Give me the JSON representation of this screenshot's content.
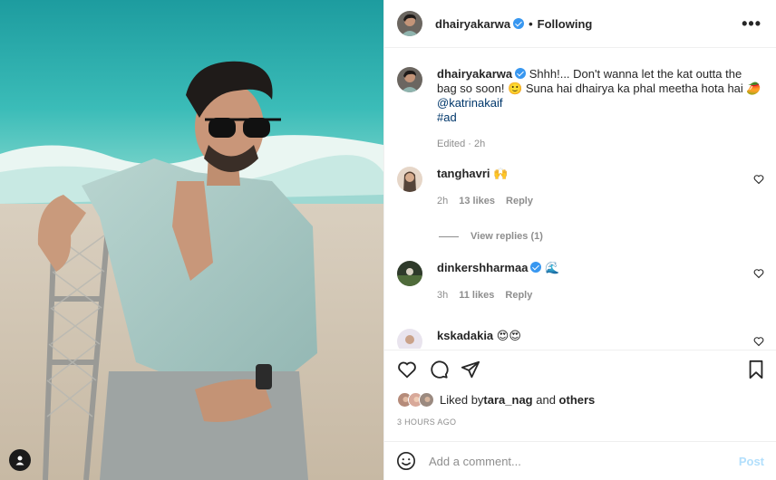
{
  "post": {
    "author": "dhairyakarwa",
    "follow_status": "Following",
    "more_icon": "more-options-icon",
    "photo_tag_icon": "user-tag-icon",
    "caption": {
      "username": "dhairyakarwa",
      "text": "Shhh!... Don't wanna let the kat outta the bag so soon! 🙂 Suna hai dhairya ka phal meetha hota hai 🥭",
      "mention": "@katrinakaif",
      "hashtag": "#ad",
      "edited": "Edited · 2h"
    },
    "comments": [
      {
        "username": "tanghavri",
        "text": "🙌",
        "time": "2h",
        "likes": "13 likes",
        "reply": "Reply",
        "verified": false
      },
      {
        "username": "dinkershharmaa",
        "text": "🌊",
        "time": "3h",
        "likes": "11 likes",
        "reply": "Reply",
        "verified": true
      },
      {
        "username": "kskadakia",
        "text": "😍😍",
        "verified": false
      }
    ],
    "view_replies": "View replies (1)",
    "liked_by_prefix": "Liked by ",
    "liked_by_user": "tara_nag",
    "liked_by_suffix": " and ",
    "liked_by_others": "others",
    "timestamp": "3 HOURS AGO",
    "add_comment_placeholder": "Add a comment...",
    "post_button": "Post"
  },
  "colors": {
    "link": "#00376b",
    "verified": "#3897f0",
    "muted": "#8e8e8e",
    "post_disabled": "#b2dffc"
  }
}
